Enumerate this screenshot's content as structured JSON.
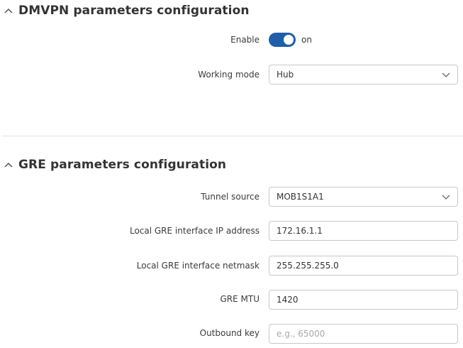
{
  "dmvpn": {
    "title": "DMVPN parameters configuration",
    "enable_label": "Enable",
    "enable_state": "on",
    "working_mode_label": "Working mode",
    "working_mode_value": "Hub"
  },
  "gre": {
    "title": "GRE parameters configuration",
    "tunnel_source_label": "Tunnel source",
    "tunnel_source_value": "MOB1S1A1",
    "local_ip_label": "Local GRE interface IP address",
    "local_ip_value": "172.16.1.1",
    "netmask_label": "Local GRE interface netmask",
    "netmask_value": "255.255.255.0",
    "mtu_label": "GRE MTU",
    "mtu_value": "1420",
    "outbound_key_label": "Outbound key",
    "outbound_key_value": "",
    "outbound_key_placeholder": "e.g., 65000"
  },
  "icons": {
    "section_toggle": "chevron-up-icon",
    "select_arrow": "chevron-down-icon"
  },
  "colors": {
    "accent": "#1f5ea8"
  }
}
